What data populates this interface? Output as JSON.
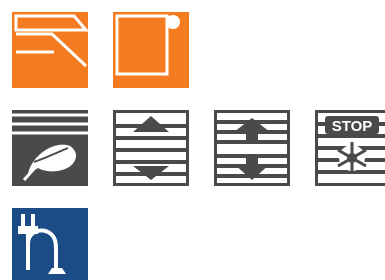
{
  "colors": {
    "orange": "#f47b20",
    "dark": "#4a4a4a",
    "navy": "#1b4c86",
    "white": "#ffffff"
  },
  "icons": {
    "row1": [
      "awning-blind-icon",
      "roller-blind-sensor-icon"
    ],
    "row2": [
      "blinds-feather-icon",
      "blinds-up-down-icon",
      "blinds-move-icon",
      "blinds-stop-frost-icon"
    ],
    "row3": [
      "power-plug-icon"
    ]
  },
  "labels": {
    "stop": "STOP"
  }
}
